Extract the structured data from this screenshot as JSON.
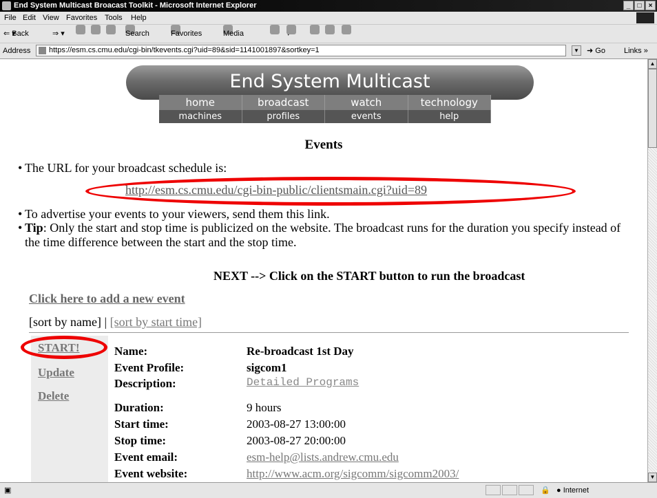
{
  "window": {
    "title": "End System Multicast Broacast Toolkit - Microsoft Internet Explorer"
  },
  "menu": [
    "File",
    "Edit",
    "View",
    "Favorites",
    "Tools",
    "Help"
  ],
  "toolbar": {
    "back": "Back",
    "search": "Search",
    "favorites": "Favorites",
    "media": "Media"
  },
  "address": {
    "label": "Address",
    "url": "https://esm.cs.cmu.edu/cgi-bin/tkevents.cgi?uid=89&sid=1141001897&sortkey=1",
    "go": "Go",
    "links": "Links"
  },
  "banner": "End System Multicast",
  "nav_primary": [
    "home",
    "broadcast",
    "watch",
    "technology"
  ],
  "nav_secondary": [
    "machines",
    "profiles",
    "events",
    "help"
  ],
  "page_title": "Events",
  "bullets": {
    "schedule_text": "The URL for your broadcast schedule is:",
    "schedule_url": "http://esm.cs.cmu.edu/cgi-bin-public/clientsmain.cgi?uid=89",
    "advertise": "To advertise your events to your viewers, send them this link.",
    "tip_label": "Tip",
    "tip_text": ": Only the start and stop time is publicized on the website. The broadcast runs for the duration you specify instead of the time difference between the start and the stop time."
  },
  "next_text": "NEXT --> Click on the START button to run the broadcast",
  "add_event": "Click here to add a new event",
  "sort": {
    "by_name": "[sort by name]",
    "sep": " | ",
    "by_start": "[sort by start time]"
  },
  "actions": {
    "start": "START!",
    "update": "Update",
    "delete": "Delete"
  },
  "event": {
    "name_label": "Name:",
    "name": "Re-broadcast 1st Day",
    "profile_label": "Event Profile:",
    "profile": "sigcom1",
    "description_label": "Description:",
    "description": "Detailed Programs",
    "duration_label": "Duration:",
    "duration": "9 hours",
    "start_label": "Start time:",
    "start": "2003-08-27 13:00:00",
    "stop_label": "Stop time:",
    "stop": "2003-08-27 20:00:00",
    "email_label": "Event email:",
    "email": "esm-help@lists.andrew.cmu.edu",
    "website_label": "Event website:",
    "website": "http://www.acm.org/sigcomm/sigcomm2003/"
  },
  "status": {
    "zone": "Internet"
  }
}
